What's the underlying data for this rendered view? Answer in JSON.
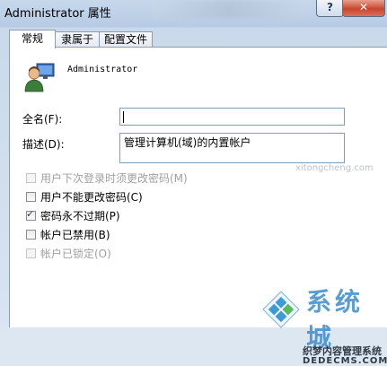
{
  "window": {
    "title": "Administrator 属性",
    "help_label": "?",
    "close_label": "✕"
  },
  "tabs": [
    {
      "label": "常规"
    },
    {
      "label": "隶属于"
    },
    {
      "label": "配置文件"
    }
  ],
  "user": {
    "name": "Administrator",
    "icon": "user-avatar-icon"
  },
  "fields": {
    "fullname_label": "全名(F):",
    "fullname_value": "",
    "description_label": "描述(D):",
    "description_value": "管理计算机(域)的内置帐户"
  },
  "checkboxes": [
    {
      "label": "用户下次登录时须更改密码(M)",
      "checked": false,
      "enabled": false
    },
    {
      "label": "用户不能更改密码(C)",
      "checked": false,
      "enabled": true
    },
    {
      "label": "密码永不过期(P)",
      "checked": true,
      "enabled": true
    },
    {
      "label": "帐户已禁用(B)",
      "checked": false,
      "enabled": true
    },
    {
      "label": "帐户已锁定(O)",
      "checked": false,
      "enabled": false
    }
  ],
  "watermark": {
    "corner_text": "xitongcheng.com",
    "brand_text": "系统城",
    "brand_sub": "织梦内容管理系统",
    "brand_url": "DEDECMS.COM"
  }
}
